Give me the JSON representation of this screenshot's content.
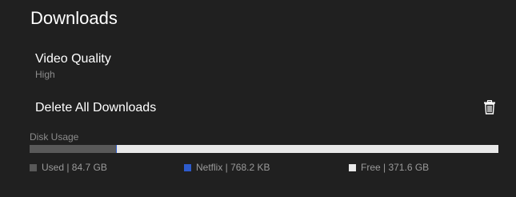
{
  "page": {
    "title": "Downloads"
  },
  "video_quality": {
    "label": "Video Quality",
    "value": "High"
  },
  "delete_all": {
    "label": "Delete All Downloads",
    "icon": "trash-icon"
  },
  "disk_usage": {
    "label": "Disk Usage",
    "used_fraction": 0.185,
    "netflix_fraction": 0.0016,
    "legend": [
      {
        "key": "used",
        "label": "Used | 84.7 GB",
        "color": "#595959"
      },
      {
        "key": "netflix",
        "label": "Netflix | 768.2 KB",
        "color": "#2d5bcc"
      },
      {
        "key": "free",
        "label": "Free | 371.6 GB",
        "color": "#e8e8e8"
      }
    ]
  }
}
